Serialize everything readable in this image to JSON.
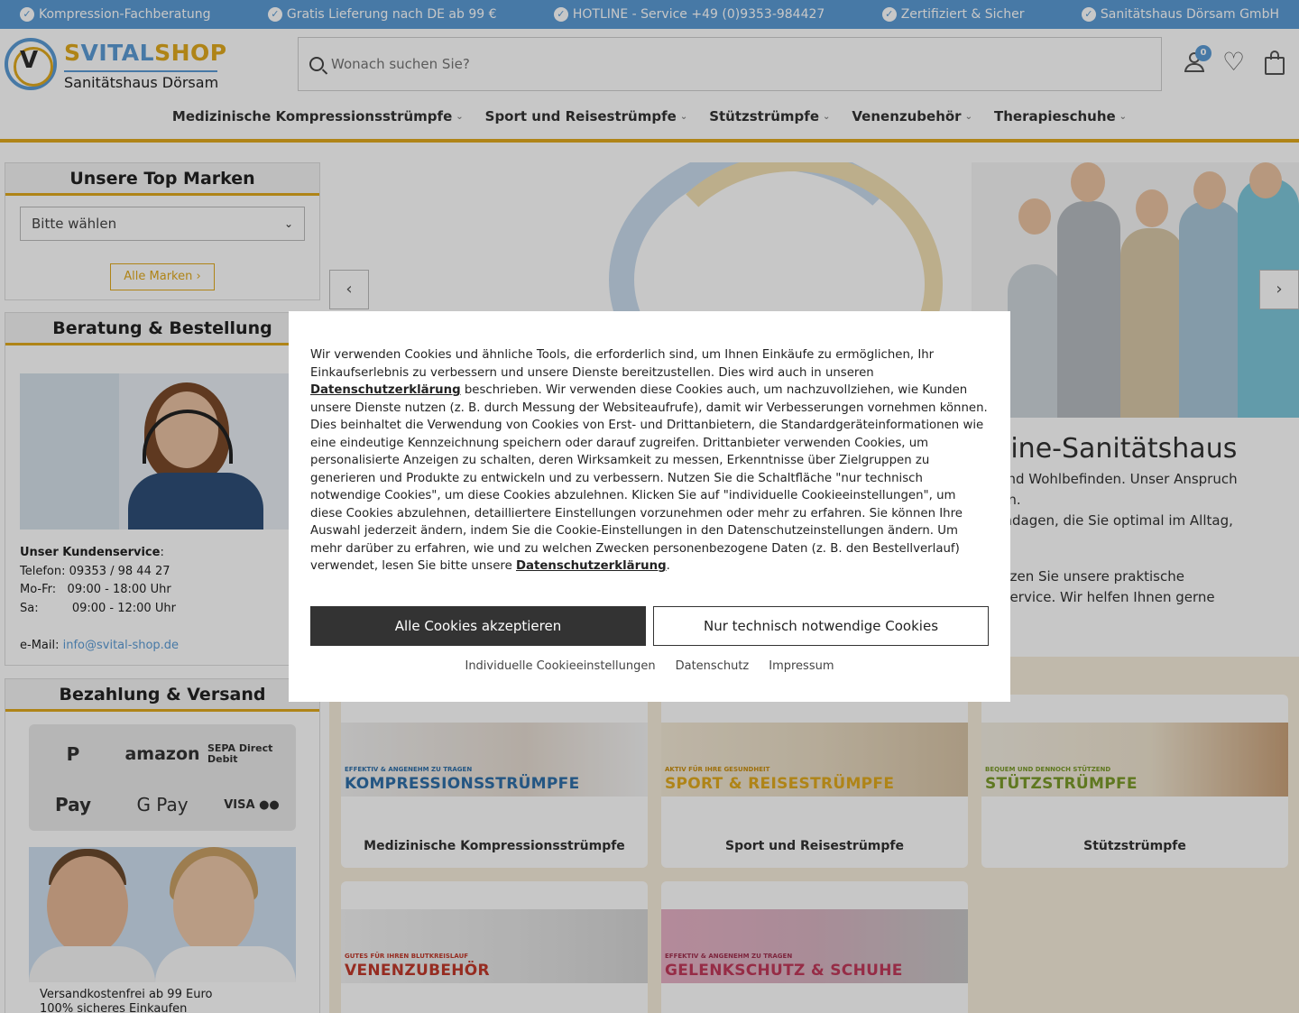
{
  "topbar": {
    "items": [
      "Kompression-Fachberatung",
      "Gratis Lieferung nach DE ab 99 €",
      "HOTLINE - Service +49 (0)9353-984427",
      "Zertifiziert & Sicher",
      "Sanitätshaus Dörsam GmbH"
    ]
  },
  "logo": {
    "brand_s": "S",
    "brand_vital": "VITAL",
    "brand_shop": "SHOP",
    "check": "V",
    "subtitle": "Sanitätshaus Dörsam"
  },
  "search": {
    "placeholder": "Wonach suchen Sie?"
  },
  "header_icons": {
    "account_badge": "0"
  },
  "nav": {
    "items": [
      "Medizinische Kompressionsstrümpfe",
      "Sport und Reisestrümpfe",
      "Stützstrümpfe",
      "Venenzubehör",
      "Therapieschuhe"
    ]
  },
  "sidebar": {
    "brands": {
      "title": "Unsere Top Marken",
      "select_value": "Bitte wählen",
      "all_button": "Alle Marken"
    },
    "contact": {
      "title": "Beratung & Bestellung",
      "service_label": "Unser Kundenservice",
      "phone": "Telefon: 09353 / 98 44 27",
      "hours_week_label": "Mo-Fr:",
      "hours_week": "09:00 - 18:00 Uhr",
      "hours_sat_label": "Sa:",
      "hours_sat": "09:00 - 12:00 Uhr",
      "email_label": "e-Mail:",
      "email": "info@svital-shop.de"
    },
    "payment": {
      "title": "Bezahlung & Versand",
      "methods": [
        "P",
        "amazon",
        "SEPA Direct Debit",
        " Pay",
        "G Pay",
        "VISA ●●"
      ],
      "promo_line1": "Versandkostenfrei ab 99 Euro",
      "promo_line2": "100% sicheres Einkaufen"
    }
  },
  "hero": {
    "title": "nline-Sanitätshaus",
    "text_lines": [
      "e und Wohlbefinden. Unser Anspruch",
      "eten.",
      "Bandagen, die Sie optimal im Alltag,",
      "",
      " Nutzen Sie unsere praktische",
      "enservice. Wir helfen Ihnen gerne"
    ],
    "prev": "‹",
    "next": "›"
  },
  "categories": [
    {
      "label": "Medizinische Kompressionsstrümpfe",
      "banner_small": "EFFEKTIV & ANGENEHM ZU TRAGEN",
      "banner_big": "KOMPRESSIONSSTRÜMPFE",
      "color": "#2f6fa8"
    },
    {
      "label": "Sport und Reisestrümpfe",
      "banner_small": "AKTIV FÜR IHRE GESUNDHEIT",
      "banner_big": "SPORT & REISESTRÜMPFE",
      "color": "#e0a91e"
    },
    {
      "label": "Stützstrümpfe",
      "banner_small": "BEQUEM UND DENNOCH STÜTZEND",
      "banner_big": "STÜTZSTRÜMPFE",
      "color": "#7a9a2a"
    },
    {
      "label": "",
      "banner_small": "GUTES FÜR IHREN BLUTKREISLAUF",
      "banner_big": "VENENZUBEHÖR",
      "color": "#c0392b"
    },
    {
      "label": "",
      "banner_small": "EFFEKTIV & ANGENEHM ZU TRAGEN",
      "banner_big": "GELENKSCHUTZ & SCHUHE",
      "color": "#c0395a"
    }
  ],
  "cookie": {
    "text_1": "Wir verwenden Cookies und ähnliche Tools, die erforderlich sind, um Ihnen Einkäufe zu ermöglichen, Ihr Einkaufserlebnis zu verbessern und unsere Dienste bereitzustellen. Dies wird auch in unseren ",
    "link_1": "Datenschutzerklärung",
    "text_2": " beschrieben. Wir verwenden diese Cookies auch, um nachzuvollziehen, wie Kunden unsere Dienste nutzen (z. B. durch Messung der Websiteaufrufe), damit wir Verbesserungen vornehmen können. Dies beinhaltet die Verwendung von Cookies von Erst- und Drittanbietern, die Standardgeräteinformationen wie eine eindeutige Kennzeichnung speichern oder darauf zugreifen. Drittanbieter verwenden Cookies, um personalisierte Anzeigen zu schalten, deren Wirksamkeit zu messen, Erkenntnisse über Zielgruppen zu generieren und Produkte zu entwickeln und zu verbessern. Nutzen Sie die Schaltfläche \"nur technisch notwendige Cookies\", um diese Cookies abzulehnen. Klicken Sie auf \"individuelle Cookieeinstellungen\", um diese Cookies abzulehnen, detailliertere Einstellungen vorzunehmen oder mehr zu erfahren. Sie können Ihre Auswahl jederzeit ändern, indem Sie die Cookie-Einstellungen in den Datenschutzeinstellungen ändern. Um mehr darüber zu erfahren, wie und zu welchen Zwecken personenbezogene Daten (z. B. den Bestellverlauf) verwendet, lesen Sie bitte unsere ",
    "link_2": "Datenschutzerklärung",
    "text_3": ".",
    "accept_all": "Alle Cookies akzeptieren",
    "only_necessary": "Nur technisch notwendige Cookies",
    "links": [
      "Individuelle Cookieeinstellungen",
      "Datenschutz",
      "Impressum"
    ]
  },
  "colors": {
    "accent_blue": "#5b9bd5",
    "accent_gold": "#e0a91e",
    "dark_button": "#333333"
  }
}
